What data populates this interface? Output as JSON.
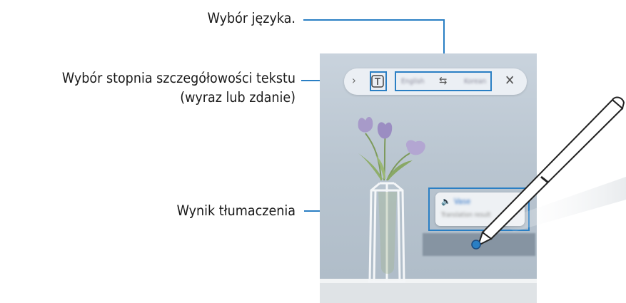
{
  "callouts": {
    "language": "Wybór języka.",
    "granularity_line1": "Wybór stopnia szczegółowości tekstu",
    "granularity_line2": "(wyraz lub zdanie)",
    "result": "Wynik tłumaczenia"
  },
  "toolbar": {
    "expand_icon": "chevron-right-icon",
    "text_mode_icon": "text-mode-icon",
    "source_language": "English",
    "swap_icon": "swap-arrows-icon",
    "target_language": "Korean",
    "close_icon": "close-icon"
  },
  "translation_popup": {
    "speaker_icon": "speaker-icon",
    "translated_word": "Vase",
    "secondary_text": "Translation result"
  },
  "colors": {
    "callout_line": "#2a7fc4",
    "background_wall": "#b9c5d0"
  }
}
